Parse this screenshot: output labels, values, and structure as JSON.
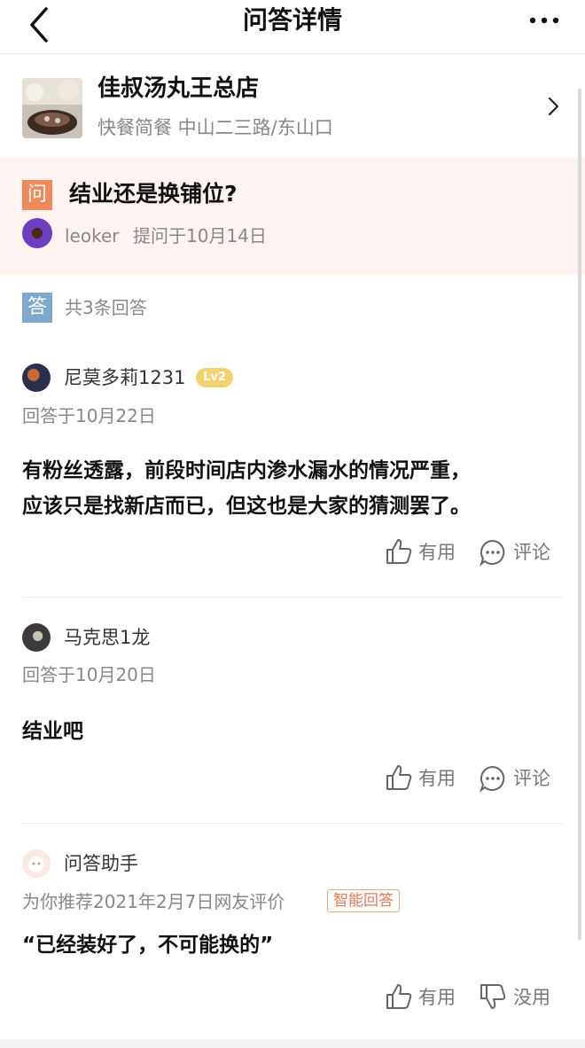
{
  "header": {
    "title": "问答详情"
  },
  "shop": {
    "name": "佳叔汤丸王总店",
    "meta": "快餐简餐 中山二三路/东山口"
  },
  "question": {
    "badge": "问",
    "text": "结业还是换铺位?",
    "user": "leoker",
    "time": "提问于10月14日"
  },
  "answers_header": {
    "badge": "答",
    "count_text": "共3条回答"
  },
  "answers": [
    {
      "user": "尼莫多莉1231",
      "level": "Lv2",
      "time": "回答于10月22日",
      "body_line1": "有粉丝透露，前段时间店内渗水漏水的情况严重，",
      "body_line2": "应该只是找新店而已，但这也是大家的猜测罢了。",
      "useful_label": "有用",
      "comment_label": "评论"
    },
    {
      "user": "马克思1龙",
      "time": "回答于10月20日",
      "body": "结业吧",
      "useful_label": "有用",
      "comment_label": "评论"
    },
    {
      "user": "问答助手",
      "recommend": "为你推荐2021年2月7日网友评价",
      "tag": "智能回答",
      "body": "“已经装好了，不可能换的”",
      "useful_label": "有用",
      "useless_label": "没用"
    }
  ],
  "colors": {
    "question_bg": "#fdf3f1",
    "question_badge": "#f08a5d",
    "answer_badge": "#7fa8cc",
    "level_badge": "#f3d271",
    "tag_border": "#e8a68c"
  },
  "icons": [
    "back-arrow-icon",
    "more-dots-icon",
    "chevron-right-icon",
    "thumbs-up-icon",
    "comment-icon",
    "thumbs-down-icon"
  ]
}
